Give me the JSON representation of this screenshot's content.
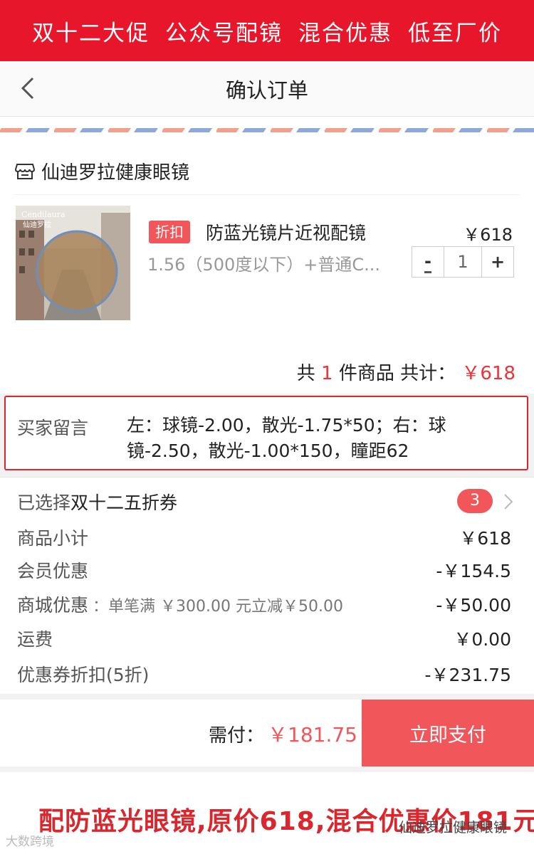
{
  "banner": {
    "items": [
      "双十二大促",
      "公众号配镜",
      "混合优惠",
      "低至厂价"
    ]
  },
  "header": {
    "title": "确认订单"
  },
  "store": {
    "name": "仙迪罗拉健康眼镜"
  },
  "product": {
    "badge": "折扣",
    "name": "防蓝光镜片近视配镜",
    "price": "￥618",
    "spec": "1.56（500度以下）+普通C...",
    "quantity": "1",
    "minus": "-",
    "plus": "+"
  },
  "total": {
    "prefix": "共",
    "count": "1",
    "middle": "件商品 共计：",
    "amount": "￥618"
  },
  "message": {
    "label": "买家留言",
    "text": "左：球镜-2.00，散光-1.75*50；右：球镜-2.50，散光-1.00*150，瞳距62"
  },
  "coupon": {
    "prefix": "已选择",
    "name": "双十二五折券",
    "count": "3"
  },
  "summary": [
    {
      "label": "商品小计",
      "note": "",
      "value": "￥618"
    },
    {
      "label": "会员优惠",
      "note": "",
      "value": "-￥154.5"
    },
    {
      "label": "商城优惠",
      "note": "：单笔满 ￥300.00 元立减￥50.00",
      "value": "-￥50.00"
    },
    {
      "label": "运费",
      "note": "",
      "value": "￥0.00"
    },
    {
      "label": "优惠券折扣(5折)",
      "note": "",
      "value": "-￥231.75"
    }
  ],
  "pay": {
    "label": "需付：",
    "amount": "￥181.75",
    "button": "立即支付"
  },
  "caption": "配防蓝光眼镜,原价618,混合优惠价181元",
  "watermarks": {
    "left": "大数跨境",
    "right": "仙迪罗拉健康眼镜"
  },
  "colors": {
    "brand_red": "#e8162b",
    "accent": "#f0565a"
  }
}
